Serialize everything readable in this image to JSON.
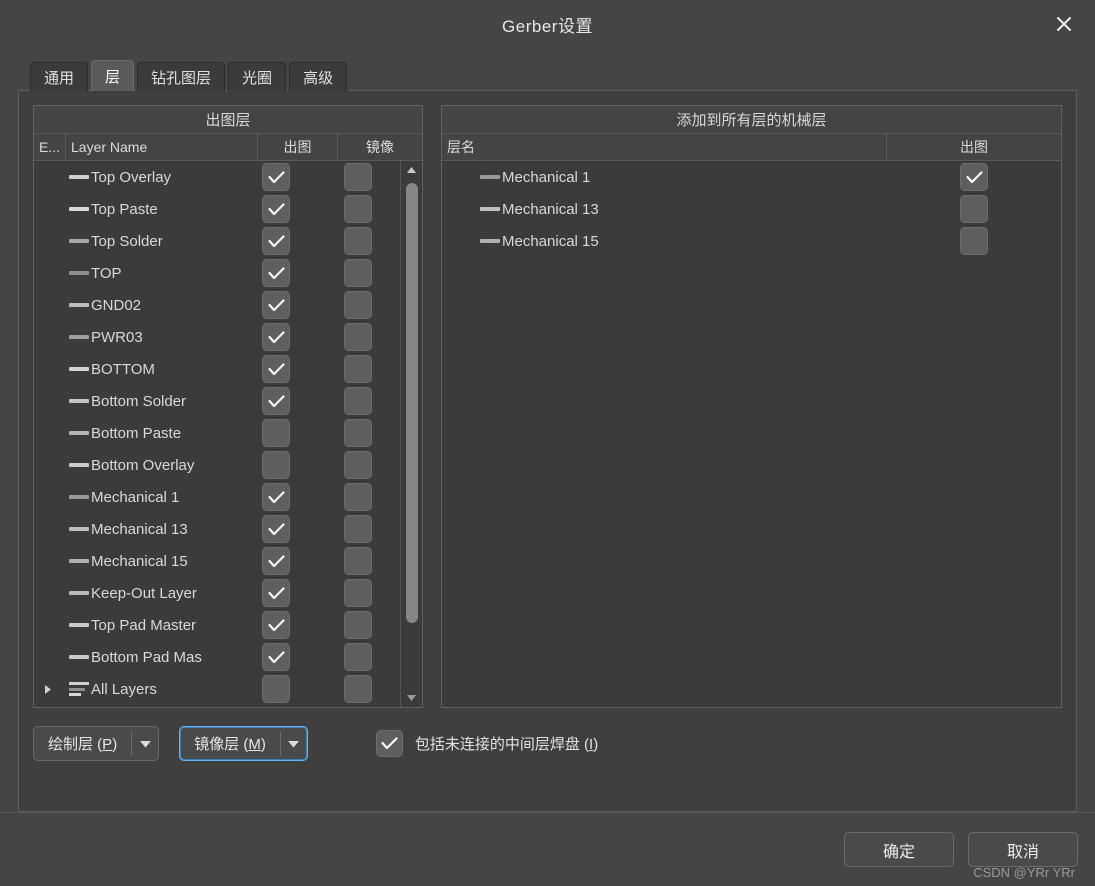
{
  "window": {
    "title": "Gerber设置",
    "close_icon": "close-icon"
  },
  "tabs": [
    {
      "label": "通用",
      "active": false
    },
    {
      "label": "层",
      "active": true
    },
    {
      "label": "钻孔图层",
      "active": false
    },
    {
      "label": "光圈",
      "active": false
    },
    {
      "label": "高级",
      "active": false
    }
  ],
  "left_panel": {
    "caption": "出图层",
    "columns": [
      "E...",
      "Layer Name",
      "出图",
      "镜像"
    ],
    "rows": [
      {
        "name": "Top Overlay",
        "swatch": "#cfcfcf",
        "plot": true,
        "mirror": false
      },
      {
        "name": "Top Paste",
        "swatch": "#d9d9d9",
        "plot": true,
        "mirror": false
      },
      {
        "name": "Top Solder",
        "swatch": "#a8a8a8",
        "plot": true,
        "mirror": false
      },
      {
        "name": "TOP",
        "swatch": "#8f8f8f",
        "plot": true,
        "mirror": false
      },
      {
        "name": "GND02",
        "swatch": "#bdbdbd",
        "plot": true,
        "mirror": false
      },
      {
        "name": "PWR03",
        "swatch": "#a0a0a0",
        "plot": true,
        "mirror": false
      },
      {
        "name": "BOTTOM",
        "swatch": "#d2d2d2",
        "plot": true,
        "mirror": false
      },
      {
        "name": "Bottom Solder",
        "swatch": "#c4c4c4",
        "plot": true,
        "mirror": false
      },
      {
        "name": "Bottom Paste",
        "swatch": "#b5b5b5",
        "plot": false,
        "mirror": false
      },
      {
        "name": "Bottom Overlay",
        "swatch": "#cacaca",
        "plot": false,
        "mirror": false
      },
      {
        "name": "Mechanical 1",
        "swatch": "#9a9a9a",
        "plot": true,
        "mirror": false
      },
      {
        "name": "Mechanical 13",
        "swatch": "#c0c0c0",
        "plot": true,
        "mirror": false
      },
      {
        "name": "Mechanical 15",
        "swatch": "#b0b0b0",
        "plot": true,
        "mirror": false
      },
      {
        "name": "Keep-Out Layer",
        "swatch": "#bcbcbc",
        "plot": true,
        "mirror": false
      },
      {
        "name": "Top Pad Master",
        "swatch": "#c8c8c8",
        "plot": true,
        "mirror": false
      },
      {
        "name": "Bottom Pad Mas",
        "swatch": "#c8c8c8",
        "plot": true,
        "mirror": false
      },
      {
        "name": "All Layers",
        "swatch": "multi",
        "plot": false,
        "mirror": false,
        "expander": true
      }
    ],
    "scrollbar": {
      "up_icon": "triangle-up-icon",
      "down_icon": "triangle-down-icon"
    }
  },
  "right_panel": {
    "caption": "添加到所有层的机械层",
    "columns": [
      "层名",
      "出图"
    ],
    "rows": [
      {
        "name": "Mechanical 1",
        "swatch": "#9a9a9a",
        "plot": true
      },
      {
        "name": "Mechanical 13",
        "swatch": "#c0c0c0",
        "plot": false
      },
      {
        "name": "Mechanical 15",
        "swatch": "#b0b0b0",
        "plot": false
      }
    ]
  },
  "controls": {
    "plot_layers_button": {
      "label": "绘制层 (P)",
      "mnemonic": "P",
      "caret_icon": "caret-down-icon"
    },
    "mirror_layers_button": {
      "label": "镜像层 (M)",
      "mnemonic": "M",
      "caret_icon": "caret-down-icon",
      "focused": true
    },
    "include_unconnected": {
      "label": "包括未连接的中间层焊盘 (I)",
      "mnemonic": "I",
      "checked": true
    }
  },
  "footer": {
    "ok_label": "确定",
    "cancel_label": "取消",
    "watermark": "CSDN @YRr YRr"
  },
  "colors": {
    "dialog_bg": "#454545",
    "panel_bg": "#3b3b3b",
    "tabpanel_bg": "#3f3f3f",
    "header_bg": "#444444",
    "accent_focus": "#66b5f0",
    "checkbox_bg": "#5e5e5e"
  }
}
